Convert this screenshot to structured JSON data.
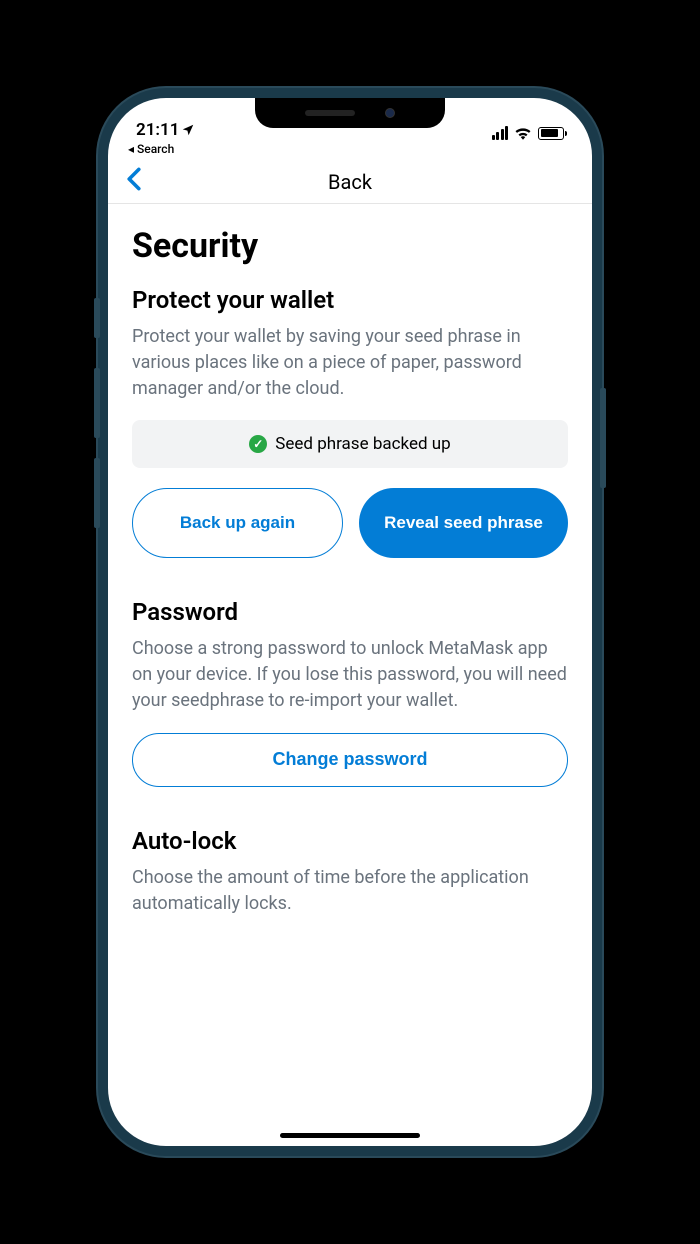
{
  "statusBar": {
    "time": "21:11",
    "breadcrumb": "Search"
  },
  "nav": {
    "title": "Back"
  },
  "page": {
    "title": "Security"
  },
  "protect": {
    "heading": "Protect your wallet",
    "body": "Protect your wallet by saving your seed phrase in various places like on a piece of paper, password manager and/or the cloud.",
    "status": "Seed phrase backed up",
    "backup_btn": "Back up again",
    "reveal_btn": "Reveal seed phrase"
  },
  "password": {
    "heading": "Password",
    "body": "Choose a strong password to unlock MetaMask app on your device. If you lose this password, you will need your seedphrase to re-import your wallet.",
    "change_btn": "Change password"
  },
  "autolock": {
    "heading": "Auto-lock",
    "body": "Choose the amount of time before the application automatically locks."
  }
}
